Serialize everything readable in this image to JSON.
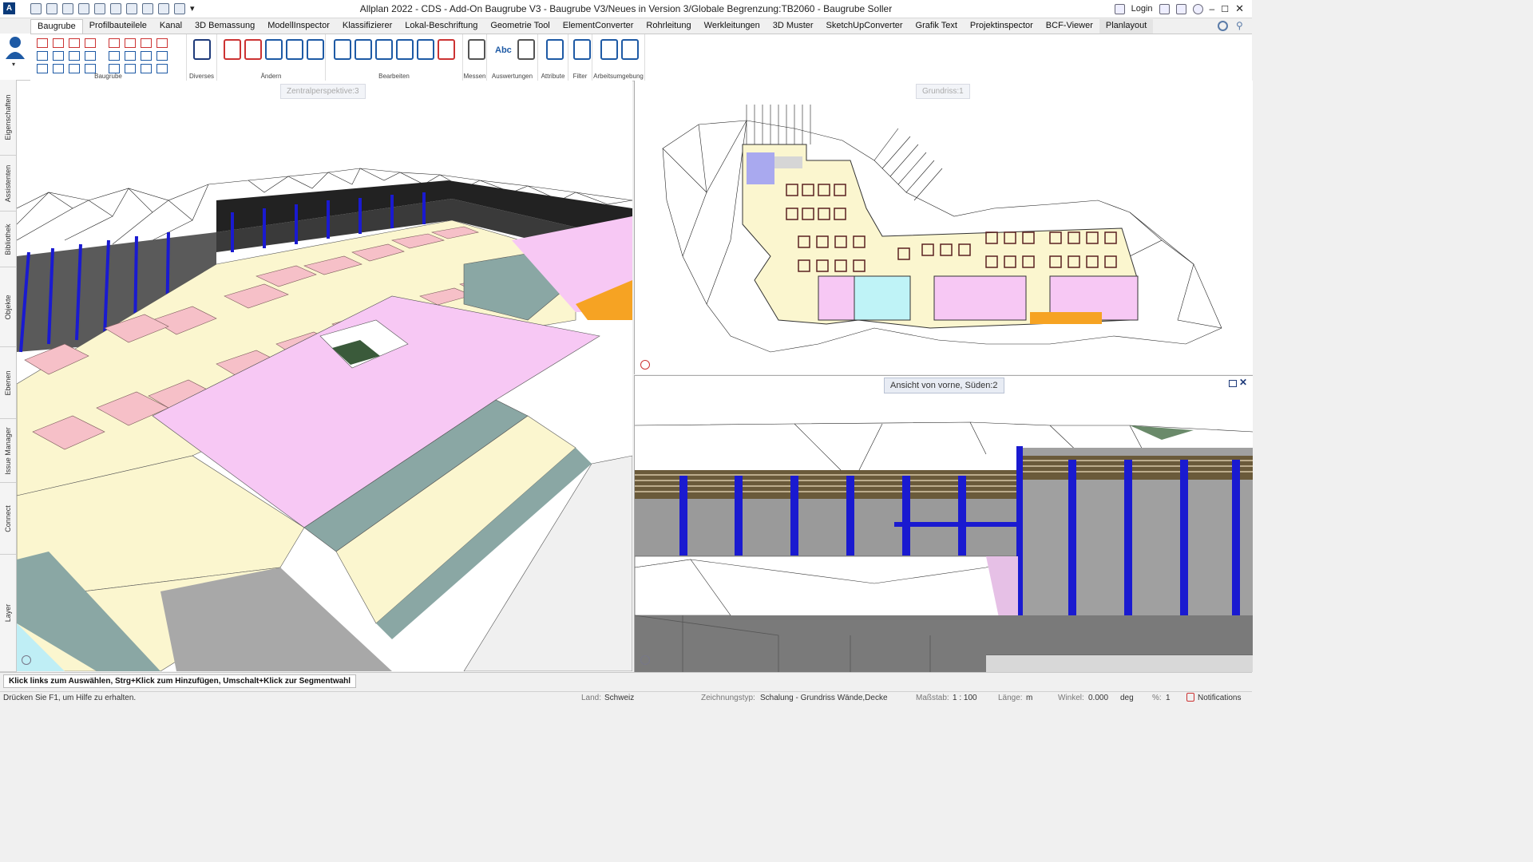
{
  "window": {
    "title": "Allplan 2022 - CDS - Add-On Baugrube V3 - Baugrube V3/Neues in Version 3/Globale Begrenzung:TB2060 - Baugrube Soller",
    "login_label": "Login"
  },
  "ribbon_tabs": [
    {
      "label": "Baugrube",
      "active": true
    },
    {
      "label": "Profilbauteilele"
    },
    {
      "label": "Kanal"
    },
    {
      "label": "3D Bemassung"
    },
    {
      "label": "ModellInspector"
    },
    {
      "label": "Klassifizierer"
    },
    {
      "label": "Lokal-Beschriftung"
    },
    {
      "label": "Geometrie Tool"
    },
    {
      "label": "ElementConverter"
    },
    {
      "label": "Rohrleitung"
    },
    {
      "label": "Werkleitungen"
    },
    {
      "label": "3D Muster"
    },
    {
      "label": "SketchUpConverter"
    },
    {
      "label": "Grafik Text"
    },
    {
      "label": "Projektinspector"
    },
    {
      "label": "BCF-Viewer"
    },
    {
      "label": "Planlayout"
    }
  ],
  "ribbon_groups": {
    "baugrube": "Baugrube",
    "diverses": "Diverses",
    "aendern": "Ändern",
    "bearbeiten": "Bearbeiten",
    "messen": "Messen",
    "auswertungen": "Auswertungen",
    "attribute": "Attribute",
    "filter": "Filter",
    "arbeitsumgebung": "Arbeitsumgebung"
  },
  "ribbon_text": {
    "abc": "Abc"
  },
  "side_tabs": [
    "Eigenschaften",
    "Assistenten",
    "Bibliothek",
    "Objekte",
    "Ebenen",
    "Issue Manager",
    "Connect",
    "Layer"
  ],
  "viewports": {
    "perspective": "Zentralperspektive:3",
    "plan": "Grundriss:1",
    "front": "Ansicht von vorne, Süden:2"
  },
  "hint": "Klick links zum Auswählen, Strg+Klick zum Hinzufügen, Umschalt+Klick zur Segmentwahl",
  "status": {
    "help": "Drücken Sie F1, um Hilfe zu erhalten.",
    "land_label": "Land:",
    "land_value": "Schweiz",
    "drawing_type_label": "Zeichnungstyp:",
    "drawing_type_value": "Schalung - Grundriss Wände,Decke",
    "scale_label": "Maßstab:",
    "scale_value": "1 : 100",
    "length_label": "Länge:",
    "length_value": "m",
    "angle_label": "Winkel:",
    "angle_value": "0.000",
    "angle_unit": "deg",
    "percent_label": "%:",
    "percent_value": "1",
    "notifications": "Notifications"
  },
  "colors": {
    "accent": "#1a1ad0",
    "pink": "#f7c8f4",
    "cream": "#fbf6cf",
    "teal": "#8aa7a4"
  }
}
